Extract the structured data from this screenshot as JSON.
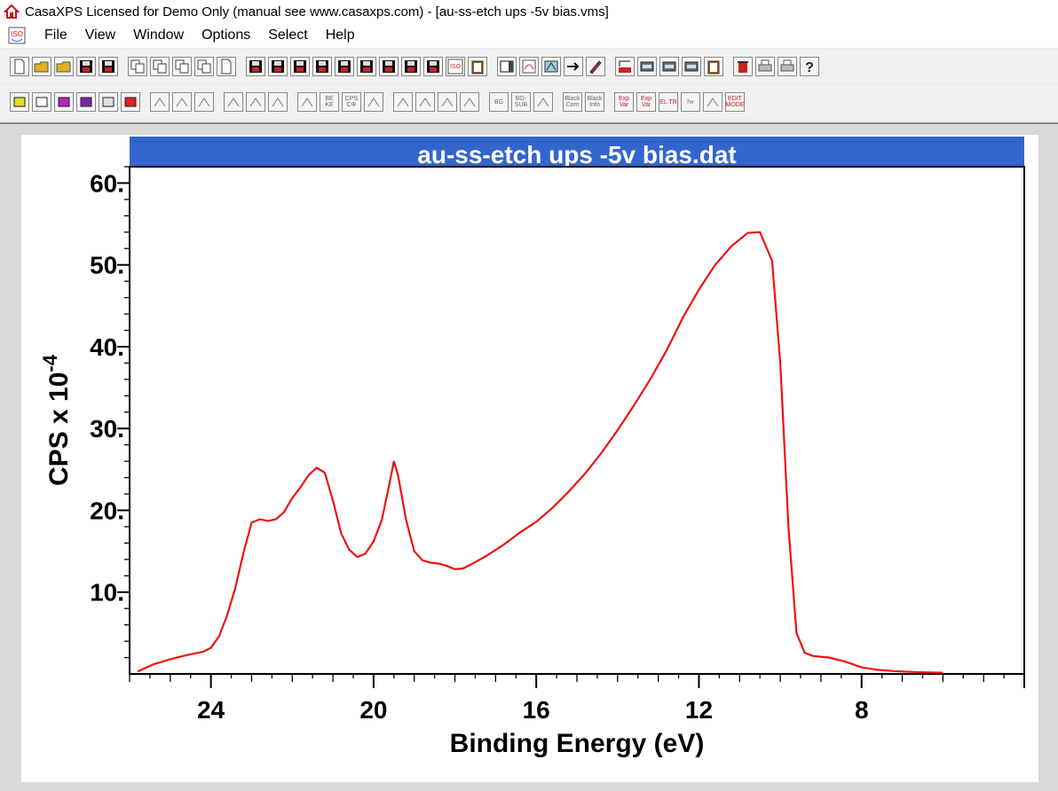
{
  "window": {
    "title": "CasaXPS Licensed for Demo Only (manual see www.casaxps.com) - [au-ss-etch ups -5v bias.vms]"
  },
  "menu": {
    "items": [
      "File",
      "View",
      "Window",
      "Options",
      "Select",
      "Help"
    ]
  },
  "toolbar1": {
    "icons": [
      "new-document-icon",
      "open-folder-icon",
      "open-folder-icon",
      "save-icon",
      "save-as-icon",
      "copy-icon",
      "copy-icon",
      "copy-icon",
      "copy-icon",
      "page-icon",
      "save-icon",
      "save-icon",
      "save-icon",
      "save-icon",
      "save-icon",
      "save-icon",
      "save-icon",
      "save-icon",
      "save-icon",
      "iso-icon",
      "clipboard-icon",
      "window-icon",
      "calibrate-icon",
      "display-icon",
      "arrow-right-icon",
      "pencil-icon",
      "library-icon",
      "tool-icon",
      "tool-icon",
      "tool-icon",
      "clipboard-icon",
      "trash-icon",
      "print-icon",
      "print-preview-icon",
      "help-icon"
    ]
  },
  "toolbar2": {
    "labels": [
      "",
      "",
      "",
      "",
      "",
      "",
      "",
      "",
      "",
      "",
      "",
      "",
      "",
      "BE KE",
      "CPS CΦ",
      "",
      "",
      "",
      "",
      "",
      "BG",
      "BG- SUB",
      "",
      "Black Com",
      "Black Info",
      "Exp Var",
      "Exp Var",
      "EL TR",
      "hv",
      "",
      "EDIT MODE"
    ]
  },
  "colors": {
    "title_band": "#3366cc",
    "trace": "#ee1111",
    "plot_bg": "#ffffff",
    "frame_bg": "#d9d9d9"
  },
  "chart_data": {
    "type": "line",
    "title": "au-ss-etch ups -5v bias.dat",
    "xlabel": "Binding Energy (eV)",
    "ylabel": "CPS x 10",
    "ylabel_exponent": "-4",
    "x_reversed": true,
    "xlim": [
      26.0,
      4.0
    ],
    "ylim": [
      0,
      62
    ],
    "xticks": [
      24,
      20,
      16,
      12,
      8
    ],
    "yticks": [
      10,
      20,
      30,
      40,
      50,
      60
    ],
    "x": [
      25.8,
      25.4,
      25.0,
      24.6,
      24.2,
      24.0,
      23.8,
      23.6,
      23.4,
      23.2,
      23.0,
      22.8,
      22.6,
      22.4,
      22.2,
      22.0,
      21.8,
      21.6,
      21.4,
      21.2,
      21.0,
      20.8,
      20.6,
      20.4,
      20.2,
      20.0,
      19.8,
      19.6,
      19.5,
      19.4,
      19.2,
      19.0,
      18.8,
      18.6,
      18.4,
      18.2,
      18.0,
      17.8,
      17.6,
      17.2,
      16.8,
      16.4,
      16.0,
      15.6,
      15.2,
      14.8,
      14.4,
      14.0,
      13.6,
      13.2,
      12.8,
      12.4,
      12.0,
      11.6,
      11.2,
      10.8,
      10.5,
      10.2,
      10.0,
      9.8,
      9.6,
      9.4,
      9.2,
      8.8,
      8.4,
      8.0,
      7.6,
      7.2,
      6.8,
      6.4,
      6.0
    ],
    "y": [
      0.3,
      1.2,
      1.8,
      2.3,
      2.7,
      3.2,
      4.6,
      7.2,
      10.5,
      14.8,
      18.5,
      18.9,
      18.7,
      18.9,
      19.8,
      21.5,
      22.8,
      24.3,
      25.2,
      24.6,
      21.2,
      17.2,
      15.2,
      14.3,
      14.7,
      16.2,
      18.8,
      23.5,
      26.0,
      24.3,
      18.8,
      15.0,
      13.9,
      13.6,
      13.5,
      13.2,
      12.8,
      12.9,
      13.4,
      14.5,
      15.8,
      17.3,
      18.6,
      20.3,
      22.3,
      24.5,
      27.0,
      29.8,
      32.8,
      36.0,
      39.5,
      43.5,
      47.0,
      50.0,
      52.3,
      53.9,
      54.0,
      50.5,
      38.0,
      18.0,
      5.0,
      2.6,
      2.2,
      2.0,
      1.5,
      0.8,
      0.5,
      0.35,
      0.25,
      0.2,
      0.15
    ]
  }
}
